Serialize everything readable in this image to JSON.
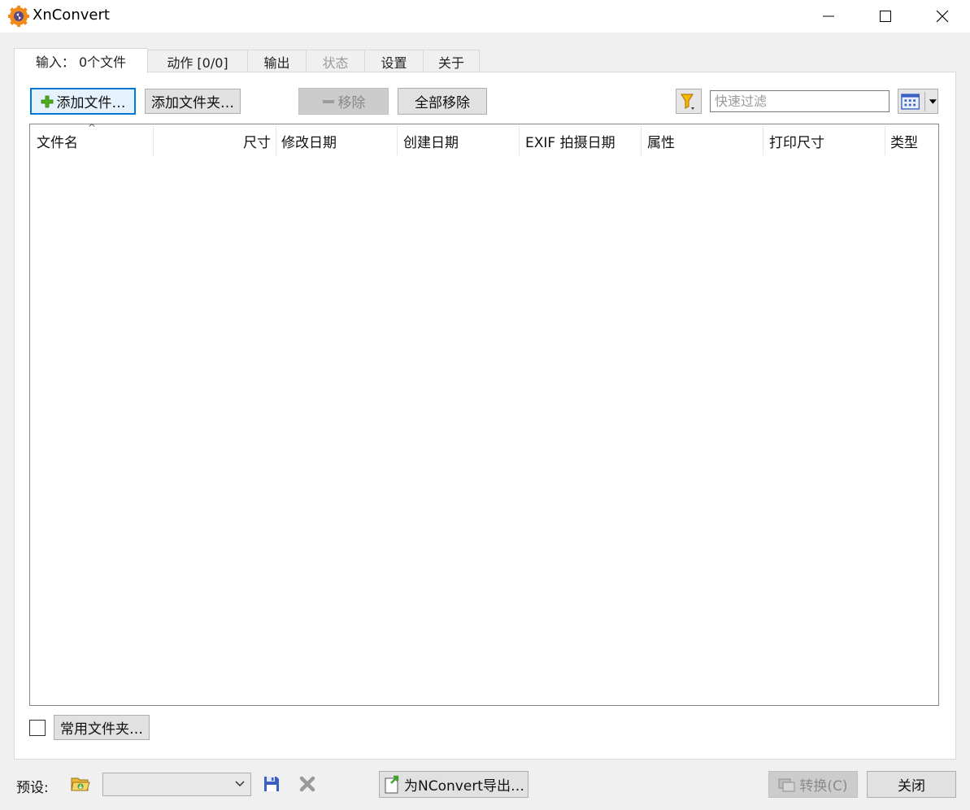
{
  "window": {
    "title": "XnConvert"
  },
  "tabs": [
    {
      "label": "输入： 0个文件",
      "active": true
    },
    {
      "label": "动作 [0/0]"
    },
    {
      "label": "输出"
    },
    {
      "label": "状态",
      "disabled": true
    },
    {
      "label": "设置"
    },
    {
      "label": "关于"
    }
  ],
  "toolbar": {
    "add_files": "添加文件…",
    "add_folder": "添加文件夹…",
    "remove": "移除",
    "remove_all": "全部移除",
    "filter_placeholder": "快速过滤"
  },
  "table": {
    "columns": [
      "文件名",
      "尺寸",
      "修改日期",
      "创建日期",
      "EXIF 拍摄日期",
      "属性",
      "打印尺寸",
      "类型"
    ],
    "sort_indicator": "^",
    "rows": []
  },
  "bottom": {
    "favorite_folders": "常用文件夹…",
    "preset_label": "预设:",
    "preset_value": "",
    "export_nconvert": "为NConvert导出…",
    "convert": "转换(C)",
    "close": "关闭"
  },
  "colors": {
    "focus_border": "#0078d7",
    "plus_green": "#4caf1a",
    "save_blue": "#3b5fc2"
  }
}
